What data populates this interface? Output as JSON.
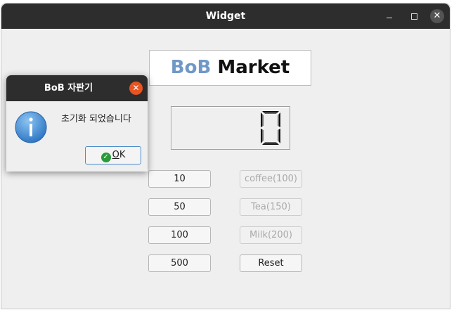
{
  "window": {
    "title": "Widget"
  },
  "logo": {
    "part1": "BoB",
    "part2": "Market"
  },
  "display": {
    "value": "0"
  },
  "coin_buttons": [
    "10",
    "50",
    "100",
    "500"
  ],
  "product_buttons": [
    {
      "label": "coffee(100)",
      "enabled": false
    },
    {
      "label": "Tea(150)",
      "enabled": false
    },
    {
      "label": "Milk(200)",
      "enabled": false
    }
  ],
  "reset_label": "Reset",
  "dialog": {
    "title": "BoB 자판기",
    "message": "초기화 되었습니다",
    "ok_label_mnemonic": "O",
    "ok_label_rest": "K"
  },
  "colors": {
    "accent": "#6f98c6",
    "dialog_close": "#e95420",
    "titlebar": "#2d2d2d"
  }
}
